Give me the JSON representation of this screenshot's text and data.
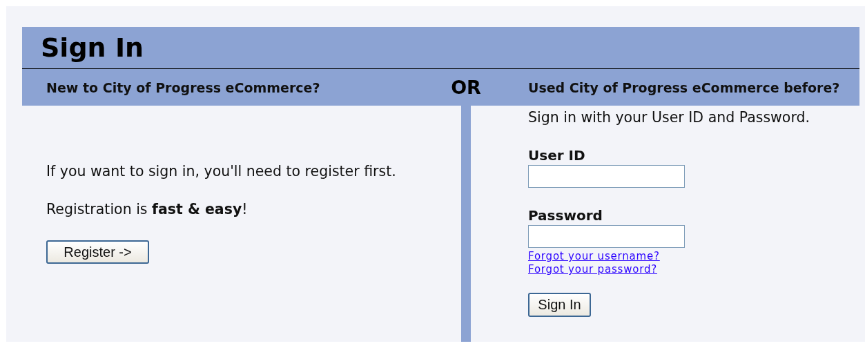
{
  "title": "Sign In",
  "new_user": {
    "heading": "New to City of Progress eCommerce?",
    "paragraphs": [
      "If you want to sign in, you'll need to register first.",
      "Registration is **fast & easy**!"
    ],
    "button": "Register ->"
  },
  "separator": "OR",
  "returning": {
    "heading": "Used City of Progress eCommerce before?",
    "intro": "Sign in with your User ID and Password.",
    "fields": [
      {
        "label": "User ID"
      },
      {
        "label": "Password"
      }
    ],
    "links": [
      "Forgot your username?",
      "Forgot your password?"
    ],
    "button": "Sign In"
  }
}
